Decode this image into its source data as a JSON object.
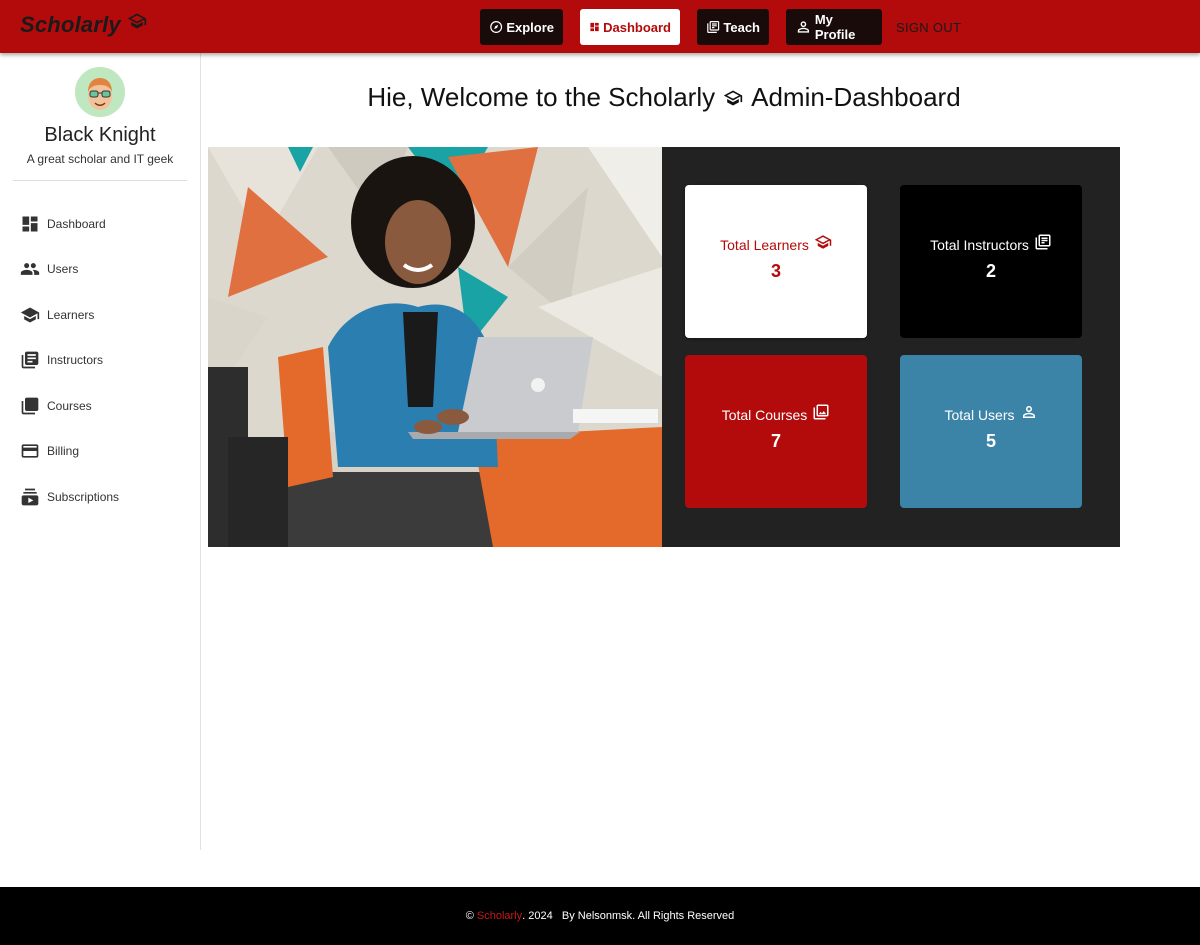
{
  "navbar": {
    "brand": "Scholarly",
    "items": [
      {
        "label": "Explore",
        "icon": "compass-icon"
      },
      {
        "label": "Dashboard",
        "icon": "dashboard-icon"
      },
      {
        "label": "Teach",
        "icon": "book-icon"
      },
      {
        "label": "My Profile",
        "icon": "person-icon"
      }
    ],
    "signout_label": "SIGN OUT"
  },
  "sidebar": {
    "user_name": "Black Knight",
    "user_bio": "A great scholar and IT geek",
    "items": [
      {
        "label": "Dashboard",
        "icon": "dashboard-icon"
      },
      {
        "label": "Users",
        "icon": "people-icon"
      },
      {
        "label": "Learners",
        "icon": "school-icon"
      },
      {
        "label": "Instructors",
        "icon": "library-books-icon"
      },
      {
        "label": "Courses",
        "icon": "library-icon"
      },
      {
        "label": "Billing",
        "icon": "credit-card-icon"
      },
      {
        "label": "Subscriptions",
        "icon": "subscriptions-icon"
      }
    ]
  },
  "main": {
    "welcome_prefix": "Hie, Welcome to the Scholarly",
    "welcome_suffix": "Admin-Dashboard",
    "stats": {
      "learners": {
        "label": "Total Learners",
        "value": "3"
      },
      "instructors": {
        "label": "Total Instructors",
        "value": "2"
      },
      "courses": {
        "label": "Total Courses",
        "value": "7"
      },
      "users": {
        "label": "Total Users",
        "value": "5"
      }
    }
  },
  "footer": {
    "copyright": "©",
    "brand": "Scholarly",
    "text": ". 2024   By Nelsonmsk. All Rights Reserved"
  },
  "colors": {
    "primary": "#b30b0b",
    "dark": "#000000",
    "panel": "#222222",
    "users_card": "#3b84a8"
  }
}
